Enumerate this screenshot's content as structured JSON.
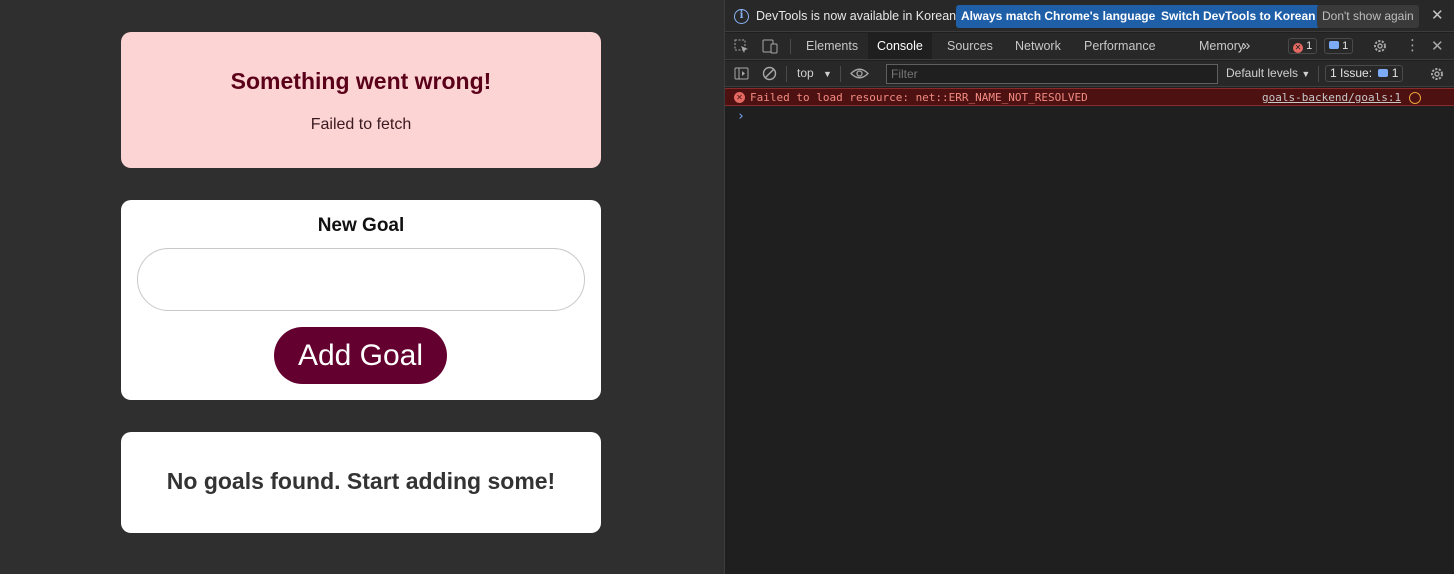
{
  "app": {
    "error": {
      "title": "Something went wrong!",
      "message": "Failed to fetch"
    },
    "form": {
      "label": "New Goal",
      "input_value": "",
      "button_label": "Add Goal"
    },
    "empty": {
      "message": "No goals found. Start adding some!"
    }
  },
  "devtools": {
    "infobar": {
      "text": "DevTools is now available in Korean!",
      "btn_match": "Always match Chrome's language",
      "btn_switch": "Switch DevTools to Korean",
      "btn_dismiss": "Don't show again"
    },
    "tabs": [
      "Elements",
      "Console",
      "Sources",
      "Network",
      "Performance",
      "Memory"
    ],
    "active_tab": "Console",
    "more_tabs_glyph": "»",
    "error_count": "1",
    "message_count": "1",
    "toolbar": {
      "context": "top",
      "filter_placeholder": "Filter",
      "levels": "Default levels",
      "issues_label": "1 Issue:",
      "issues_count": "1"
    },
    "console": {
      "message": "Failed to load resource: net::ERR_NAME_NOT_RESOLVED",
      "source": "goals-backend/goals:1",
      "prompt_glyph": "›"
    },
    "colors": {
      "error": "#e46962",
      "accent": "#8ab4f8"
    }
  }
}
